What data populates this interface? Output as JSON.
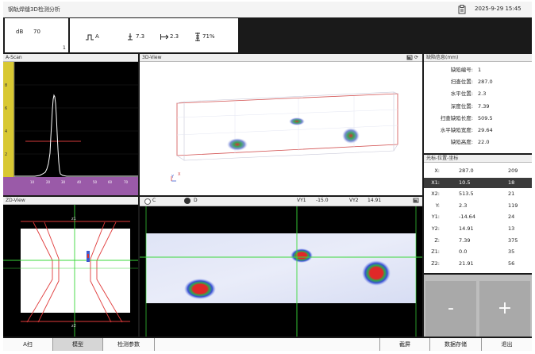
{
  "header": {
    "title": "钢轨焊缝3D检测分析",
    "icon": "clipboard-icon",
    "datetime": "2025-9-29 15:45"
  },
  "gain": {
    "label": "dB",
    "value": "70",
    "index": "1"
  },
  "status": {
    "wave_label": "A",
    "depth": "7.3",
    "horizontal": "2.3",
    "amplitude": "71%"
  },
  "ascan": {
    "title": "A-Scan",
    "y_ticks": [
      "8",
      "6",
      "4",
      "2"
    ],
    "x_ticks": [
      "10",
      "20",
      "30",
      "40",
      "50",
      "60",
      "70"
    ],
    "colors": {
      "gate_bar": "#d8c832",
      "baseline": "#9a5aa8",
      "gate": "#d23a3a",
      "signal": "#ffffff"
    }
  },
  "view3d": {
    "title": "3D-View",
    "axis_x": "X",
    "axis_y": "Y"
  },
  "defect_info": {
    "title": "缺陷信息(mm)",
    "rows": [
      {
        "label": "缺陷编号:",
        "value": "1"
      },
      {
        "label": "扫查位置:",
        "value": "287.0"
      },
      {
        "label": "水平位置:",
        "value": "2.3"
      },
      {
        "label": "深度位置:",
        "value": "7.39"
      },
      {
        "label": "扫查缺陷长度:",
        "value": "509.5"
      },
      {
        "label": "水平缺陷宽度:",
        "value": "29.64"
      },
      {
        "label": "缺陷高度:",
        "value": "22.0"
      }
    ]
  },
  "cursor_info": {
    "title": "光标-位置-坐标",
    "rows": [
      {
        "label": "X:",
        "value": "287.0",
        "extra": "209",
        "selected": false
      },
      {
        "label": "X1:",
        "value": "10.5",
        "extra": "18",
        "selected": true
      },
      {
        "label": "X2:",
        "value": "513.5",
        "extra": "21",
        "selected": false
      },
      {
        "label": "Y:",
        "value": "2.3",
        "extra": "119",
        "selected": false
      },
      {
        "label": "Y1:",
        "value": "-14.64",
        "extra": "24",
        "selected": false
      },
      {
        "label": "Y2:",
        "value": "14.91",
        "extra": "13",
        "selected": false
      },
      {
        "label": "Z:",
        "value": "7.39",
        "extra": "375",
        "selected": false
      },
      {
        "label": "Z1:",
        "value": "0.0",
        "extra": "35",
        "selected": false
      },
      {
        "label": "Z2:",
        "value": "21.91",
        "extra": "56",
        "selected": false
      }
    ]
  },
  "zd_view": {
    "title": "ZD-View",
    "z1": "z1",
    "z2": "z2"
  },
  "cscan": {
    "radio_c": "C",
    "radio_d": "D",
    "radio_selected": "D",
    "vy1_label": "VY1",
    "vy1_value": "-15.0",
    "vy2_label": "VY2",
    "vy2_value": "14.91"
  },
  "controls": {
    "minus": "-",
    "plus": "+"
  },
  "toolbar": {
    "ascan": "A扫",
    "model": "模型",
    "params": "检测参数",
    "screenshot": "截屏",
    "save": "数据存储",
    "exit": "退出"
  }
}
